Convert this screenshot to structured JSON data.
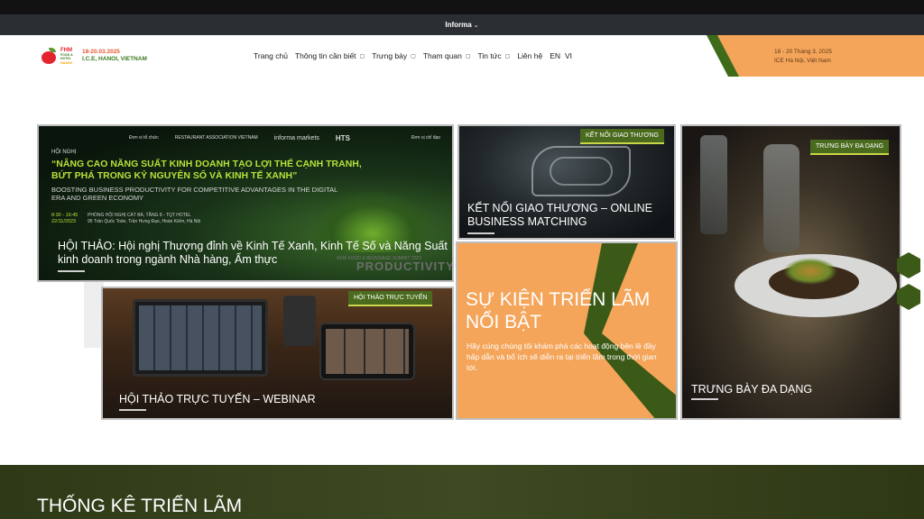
{
  "informa_bar": {
    "label": "Informa",
    "chevron_icon": "chevron-down-icon"
  },
  "logo": {
    "brand_line1": "FHM",
    "brand_line2": "FOOD & HOTEL",
    "brand_line3": "HANOI",
    "dates": "18-20.03.2025",
    "venue": "I.C.E, HANOI, VIETNAM"
  },
  "nav": {
    "items": [
      {
        "label": "Trang chủ",
        "has_dropdown": false
      },
      {
        "label": "Thông tin cần biết",
        "has_dropdown": true
      },
      {
        "label": "Trưng bày",
        "has_dropdown": true
      },
      {
        "label": "Tham quan",
        "has_dropdown": true
      },
      {
        "label": "Tin tức",
        "has_dropdown": true
      },
      {
        "label": "Liên hệ",
        "has_dropdown": false
      }
    ],
    "langs": [
      "EN",
      "VI"
    ]
  },
  "event_info": {
    "dates": "18 - 20 Tháng 3, 2025",
    "venue": "ICE Hà Nội, Việt Nam"
  },
  "cards": {
    "summit": {
      "org_label": "Đơn vị tổ chức",
      "org_label2": "Đơn vị chỉ đạo",
      "org1": "RESTAURANT ASSOCIATION VIETNAM",
      "org2": "informa markets",
      "org3": "HTS",
      "hoi_nghi": "HỘI NGHỊ",
      "banner_vi": "“NÂNG CAO NĂNG SUẤT KINH DOANH TẠO LỢI THẾ CẠNH TRANH, BỨT PHÁ TRONG KỶ NGUYÊN SỐ VÀ KINH TẾ XANH”",
      "banner_en": "BOOSTING BUSINESS PRODUCTIVITY FOR COMPETITIVE ADVANTAGES IN THE DIGITAL ERA AND GREEN ECONOMY",
      "time": "8:30 - 16:45",
      "date": "22/11/2023",
      "room": "PHÒNG HỘI NGHỊ CÁT BÀ, TẦNG 8 - TQT HOTEL",
      "address": "95 Trần Quốc Toản, Trần Hưng Đạo, Hoàn Kiếm, Hà Nội",
      "summit_tag": "ASIA FOOD & BEVERAGE SUMMIT 2023",
      "productivity": "PRODUCTIVITY",
      "title": "HỘI THẢO: Hội nghị Thượng đỉnh về Kinh Tế Xanh, Kinh Tế Số và Năng Suất kinh doanh trong ngành Nhà hàng, Ẩm thực"
    },
    "webinar": {
      "badge": "Hội thảo trực tuyến",
      "title": "HỘI THẢO TRỰC TUYẾN – WEBINAR"
    },
    "trade": {
      "badge": "Kết nối giao thương",
      "title": "KẾT NỐI GIAO THƯƠNG – ONLINE BUSINESS MATCHING"
    },
    "featured": {
      "title": "SỰ KIỆN TRIỂN LÃM NỔI BẬT",
      "desc": "Hãy cùng chúng tôi khám phá các hoạt động bên lề đầy hấp dẫn và bổ ích sẽ diễn ra tại triển lãm trong thời gian tới."
    },
    "display": {
      "badge": "Trưng bày đa dạng",
      "title": "TRƯNG BÀY ĐA DẠNG"
    }
  },
  "stats": {
    "title": "THỐNG KÊ TRIỂN LÃM"
  },
  "colors": {
    "accent_green": "#3b5a17",
    "accent_orange": "#f4a55a",
    "lime": "#b8e23a"
  }
}
